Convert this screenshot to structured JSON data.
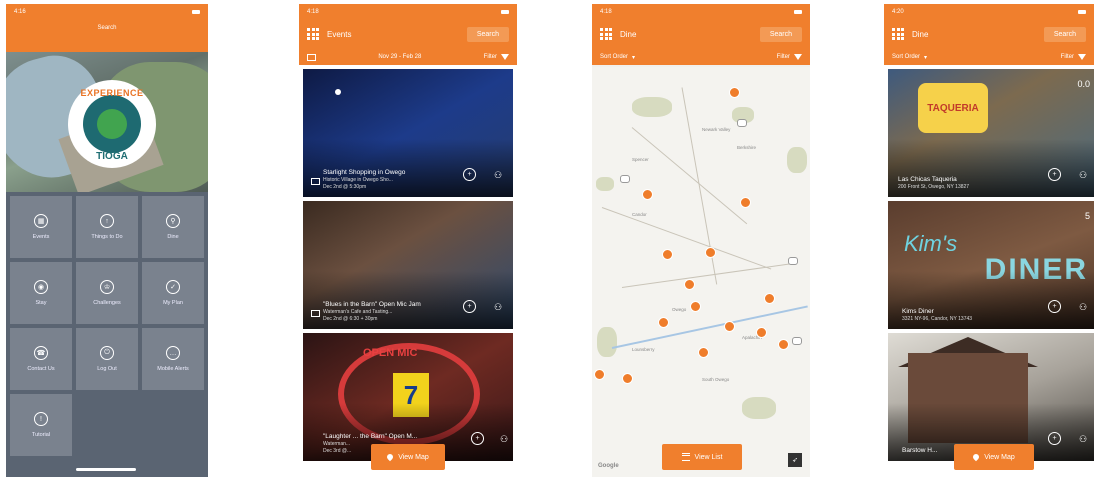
{
  "phone1": {
    "status_time": "4:16",
    "search_label": "Search",
    "logo_top": "EXPERIENCE",
    "logo_bottom": "TIOGA",
    "tiles": [
      {
        "label": "Events",
        "icon": "calendar-icon"
      },
      {
        "label": "Things to Do",
        "icon": "compass-icon"
      },
      {
        "label": "Dine",
        "icon": "fork-icon"
      },
      {
        "label": "Stay",
        "icon": "bed-icon"
      },
      {
        "label": "Challenges",
        "icon": "trophy-icon"
      },
      {
        "label": "My Plan",
        "icon": "check-icon"
      },
      {
        "label": "Contact Us",
        "icon": "phone-icon"
      },
      {
        "label": "Log Out",
        "icon": "power-icon"
      },
      {
        "label": "Mobile Alerts",
        "icon": "chat-icon"
      },
      {
        "label": "Tutorial",
        "icon": "info-icon"
      }
    ]
  },
  "phone2": {
    "status_time": "4:18",
    "title": "Events",
    "search_label": "Search",
    "date_range": "Nov 29 - Feb 28",
    "filter_label": "Filter",
    "events": [
      {
        "title": "Starlight Shopping in Owego",
        "venue": "Historic Village in Owego Sho...",
        "date": "Dec 2nd @ 5:30pm"
      },
      {
        "title": "\"Blues in the Barn\" Open Mic Jam",
        "venue": "Waterman's Cafe and Tasting...",
        "date": "Dec 2nd @ 6:30 + 30pm"
      },
      {
        "title": "\"Laughter ... the Barn\" Open M...",
        "venue": "Waterman...",
        "date": "Dec 3rd @..."
      }
    ],
    "open_mic_sign": "OPEN MIC",
    "sign_number": "7",
    "view_map_label": "View Map"
  },
  "phone3": {
    "status_time": "4:18",
    "title": "Dine",
    "search_label": "Search",
    "sort_label": "Sort Order",
    "filter_label": "Filter",
    "places": [
      "Candor",
      "Owego",
      "Apalachin",
      "Lounsberry",
      "South Owego",
      "Newark Valley",
      "Berkshire",
      "Spencer"
    ],
    "view_list_label": "View List",
    "google_label": "Google"
  },
  "phone4": {
    "status_time": "4:20",
    "title": "Dine",
    "search_label": "Search",
    "sort_label": "Sort Order",
    "filter_label": "Filter",
    "restaurants": [
      {
        "name": "Las Chicas Taqueria",
        "address": "200 Front St, Owego, NY 13827",
        "sign": "TAQUERIA"
      },
      {
        "name": "Kims Diner",
        "address": "3321 NY-96, Candor, NY 13743",
        "sign": "DINER",
        "script": "Kim's"
      },
      {
        "name": "Barstow H...",
        "address": ""
      }
    ],
    "view_map_label": "View Map",
    "counts": [
      "0.0",
      "5"
    ]
  },
  "colors": {
    "brand_orange": "#f07f2d",
    "tile_gray": "#7a828e",
    "background_gray": "#5a6472"
  }
}
